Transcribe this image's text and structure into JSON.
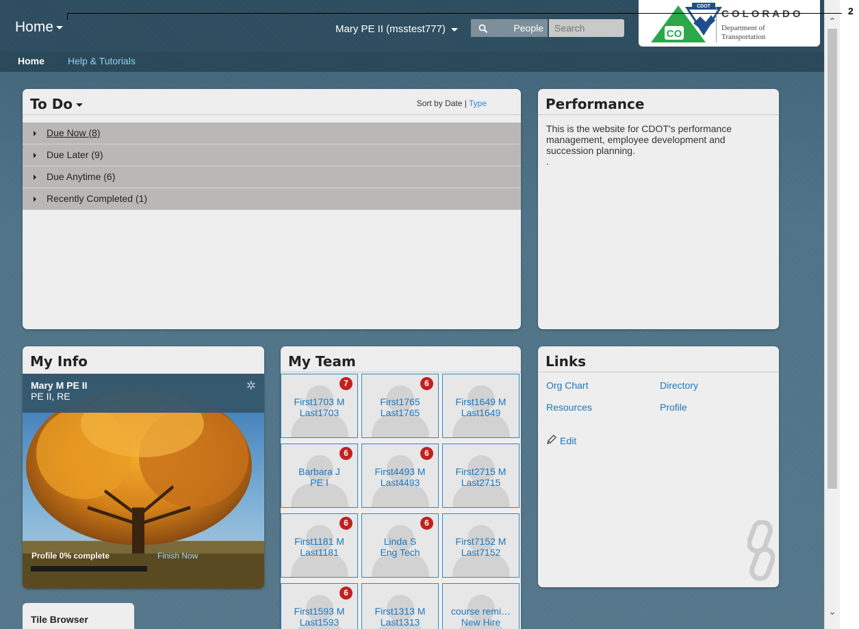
{
  "header": {
    "home_label": "Home",
    "user_label": "Mary PE II (msstest777)",
    "search_scope": "People",
    "search_placeholder": "Search"
  },
  "logo": {
    "badge": "CDOT",
    "state": "COLORADO",
    "dept_line1": "Department of",
    "dept_line2": "Transportation",
    "co_mark": "CO"
  },
  "subnav": {
    "home": "Home",
    "help": "Help & Tutorials"
  },
  "callout": {
    "number": "2"
  },
  "todo": {
    "title": "To Do",
    "sort_by": "Sort by Date | ",
    "sort_type": "Type",
    "rows": [
      "Due Now (8)",
      "Due Later (9)",
      "Due Anytime (6)",
      "Recently Completed (1)"
    ]
  },
  "performance": {
    "title": "Performance",
    "text": "This is the website for CDOT's performance management, employee development and succession planning.",
    "extra": "."
  },
  "myinfo": {
    "title": "My Info",
    "name": "Mary M PE II",
    "role": "PE II, RE",
    "profile_status": "Profile 0% complete",
    "profile_progress": 0,
    "finish_now": "Finish Now"
  },
  "myteam": {
    "title": "My Team",
    "members": [
      {
        "line1": "First1703 M",
        "line2": "Last1703",
        "badge": "7"
      },
      {
        "line1": "First1765",
        "line2": "Last1765",
        "badge": "6"
      },
      {
        "line1": "First1649 M",
        "line2": "Last1649",
        "badge": ""
      },
      {
        "line1": "Barbara J",
        "line2": "PE I",
        "badge": "6"
      },
      {
        "line1": "First4493 M",
        "line2": "Last4493",
        "badge": "6"
      },
      {
        "line1": "First2715 M",
        "line2": "Last2715",
        "badge": ""
      },
      {
        "line1": "First1181 M",
        "line2": "Last1181",
        "badge": "6"
      },
      {
        "line1": "Linda S",
        "line2": "Eng Tech",
        "badge": "6"
      },
      {
        "line1": "First7152 M",
        "line2": "Last7152",
        "badge": ""
      },
      {
        "line1": "First1593 M",
        "line2": "Last1593",
        "badge": "6"
      },
      {
        "line1": "First1313 M",
        "line2": "Last1313",
        "badge": ""
      },
      {
        "line1": "course remi…",
        "line2": "New Hire",
        "badge": ""
      }
    ]
  },
  "links": {
    "title": "Links",
    "org_chart": "Org Chart",
    "directory": "Directory",
    "resources": "Resources",
    "profile": "Profile",
    "edit": "Edit"
  },
  "tile_browser": {
    "title": "Tile Browser"
  },
  "colors": {
    "accent": "#1d77c0",
    "badge": "#c1201f",
    "header": "#2b4b5e"
  }
}
